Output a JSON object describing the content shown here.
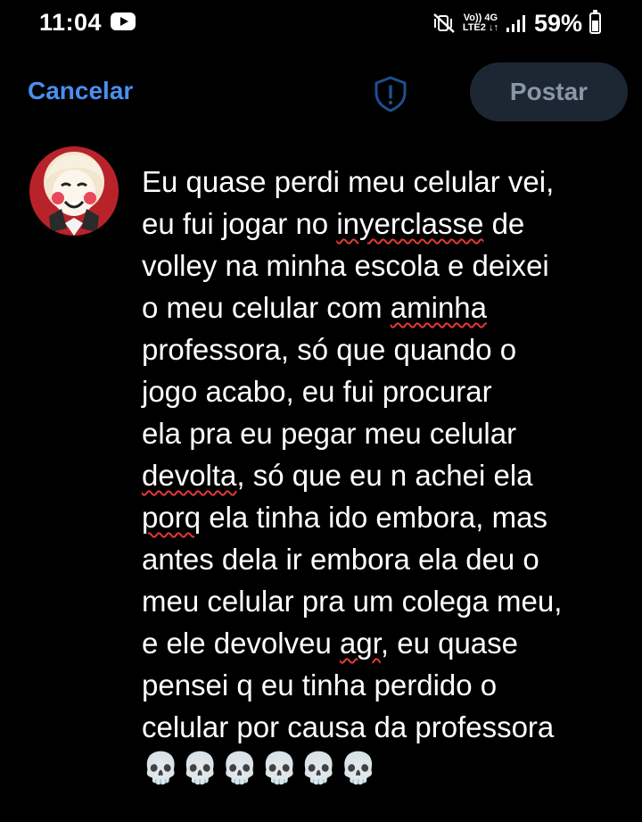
{
  "status_bar": {
    "time": "11:04",
    "network_top": "Vo)) 4G",
    "network_bottom": "LTE2 ↓↑",
    "battery_percent": "59%",
    "battery_level": 0.59
  },
  "header": {
    "cancel_label": "Cancelar",
    "post_label": "Postar"
  },
  "compose": {
    "lines": [
      [
        "Eu quase perdi meu celular vei,"
      ],
      [
        "eu fui jogar no ",
        {
          "typo": "inyerclasse"
        },
        " de"
      ],
      [
        "volley na minha escola e deixei"
      ],
      [
        "o meu celular com ",
        {
          "typo": "aminha"
        }
      ],
      [
        "professora, só que quando o"
      ],
      [
        "jogo acabo, eu fui procurar"
      ],
      [
        "ela pra eu pegar meu celular"
      ],
      [
        {
          "typo": "devolta"
        },
        ", só que eu n achei ela"
      ],
      [
        {
          "typo": "porq"
        },
        " ela tinha ido embora, mas"
      ],
      [
        "antes dela ir embora ela deu o"
      ],
      [
        "meu celular pra um colega meu,"
      ],
      [
        "e ele devolveu  ",
        {
          "typo": "agr"
        },
        ", eu quase"
      ],
      [
        "pensei q eu tinha perdido o"
      ],
      [
        "celular por causa da professora"
      ]
    ],
    "emoji": "💀💀💀💀💀💀"
  },
  "colors": {
    "accent": "#4a8ff0",
    "post_bg": "#1c2733",
    "post_text": "#8a97a6",
    "typo_underline": "#e53935"
  }
}
